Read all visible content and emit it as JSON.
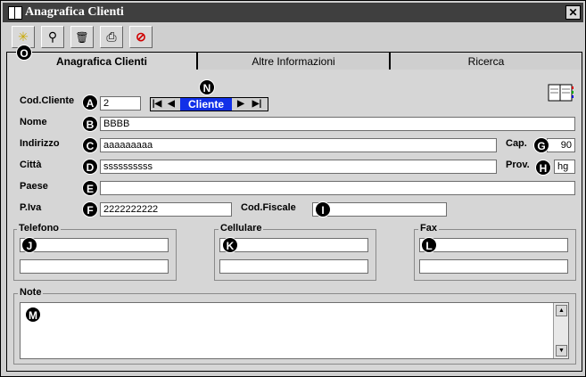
{
  "window": {
    "title": "Anagrafica Clienti",
    "close_label": "✕"
  },
  "toolbar": {
    "buttons": [
      {
        "name": "new-button",
        "icon": "sparkle-icon",
        "glyph": "✳"
      },
      {
        "name": "search-button",
        "icon": "binoculars-icon",
        "glyph": "⚲"
      },
      {
        "name": "delete-button",
        "icon": "trash-icon",
        "glyph": "🗑"
      },
      {
        "name": "print-button",
        "icon": "printer-icon",
        "glyph": "⎙"
      },
      {
        "name": "cancel-button",
        "icon": "no-entry-icon",
        "glyph": "⊘"
      }
    ]
  },
  "tabs": [
    {
      "label": "Anagrafica Clienti",
      "active": true
    },
    {
      "label": "Altre Informazioni",
      "active": false
    },
    {
      "label": "Ricerca",
      "active": false
    }
  ],
  "form": {
    "cod_cliente": {
      "label": "Cod.Cliente",
      "value": "2"
    },
    "navigator": {
      "label": "Cliente",
      "first": "|◀",
      "prev": "◀",
      "next": "▶",
      "last": "▶|"
    },
    "nome": {
      "label": "Nome",
      "value": "BBBB"
    },
    "indirizzo": {
      "label": "Indirizzo",
      "value": "aaaaaaaaa"
    },
    "cap": {
      "label": "Cap.",
      "value": "90"
    },
    "citta": {
      "label": "Città",
      "value": "ssssssssss"
    },
    "prov": {
      "label": "Prov.",
      "value": "hg"
    },
    "paese": {
      "label": "Paese",
      "value": ""
    },
    "piva": {
      "label": "P.Iva",
      "value": "2222222222"
    },
    "cod_fiscale": {
      "label": "Cod.Fiscale",
      "value": ""
    },
    "telefono": {
      "label": "Telefono",
      "values": [
        "",
        ""
      ]
    },
    "cellulare": {
      "label": "Cellulare",
      "values": [
        "",
        ""
      ]
    },
    "fax": {
      "label": "Fax",
      "values": [
        "",
        ""
      ]
    },
    "note": {
      "label": "Note",
      "value": ""
    }
  },
  "badges": {
    "A": "A",
    "B": "B",
    "C": "C",
    "D": "D",
    "E": "E",
    "F": "F",
    "G": "G",
    "H": "H",
    "I": "I",
    "J": "J",
    "K": "K",
    "L": "L",
    "M": "M",
    "N": "N",
    "O": "O"
  },
  "colors": {
    "titlebar": "#3f3f3f",
    "navigator_label": "#1130e8",
    "badge": "#000000"
  }
}
